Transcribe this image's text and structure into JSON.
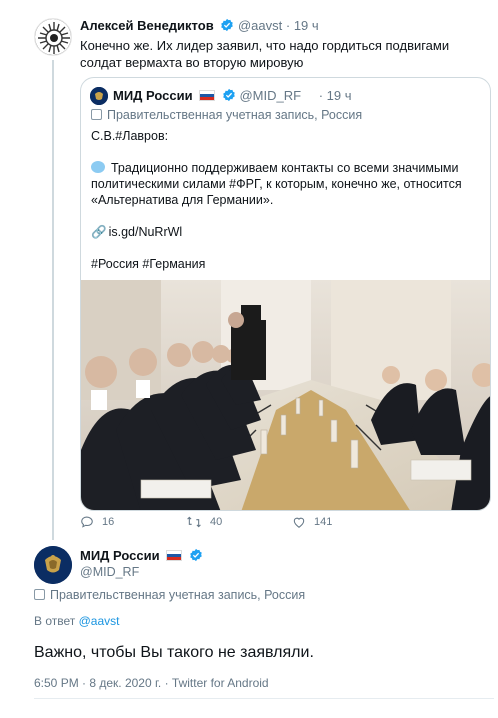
{
  "tweet": {
    "author_name": "Алексей Венедиктов",
    "handle": "@aavst",
    "separator": "·",
    "time": "19 ч",
    "text": "Конечно же. Их лидер заявил, что надо гордиться подвигами солдат вермахта во вторую мировую"
  },
  "quote": {
    "author_name": "МИД России",
    "handle": "@MID_RF",
    "separator": "·",
    "time": "19 ч",
    "gov_label": "Правительственная учетная запись, Россия",
    "line1": "С.В.#Лавров:",
    "line2": "Традиционно поддерживаем контакты со всеми значимыми",
    "line3": "политическими силами #ФРГ, к которым, конечно же, относится",
    "line4": "«Альтернатива для Германии».",
    "link": "is.gd/NuRrWl",
    "hashtags": "#Россия #Германия"
  },
  "actions": {
    "replies": "16",
    "retweets": "40",
    "likes": "141"
  },
  "reply": {
    "author_name": "МИД России",
    "handle": "@MID_RF",
    "gov_label": "Правительственная учетная запись, Россия",
    "reply_prefix": "В ответ",
    "reply_to": "@aavst",
    "text": "Важно, чтобы Вы такого не заявляли.",
    "meta": "6:50 PM · 8 дек. 2020 г. · Twitter for Android"
  },
  "colors": {
    "accent": "#1b95e0",
    "verified": "#1da1f2",
    "muted": "#657786",
    "border": "#cfd9de"
  },
  "icons": [
    "verified-badge-icon",
    "russia-flag-icon",
    "government-icon",
    "speech-bubble-emoji-icon",
    "link-emoji-icon",
    "reply-icon",
    "retweet-icon",
    "like-icon"
  ]
}
